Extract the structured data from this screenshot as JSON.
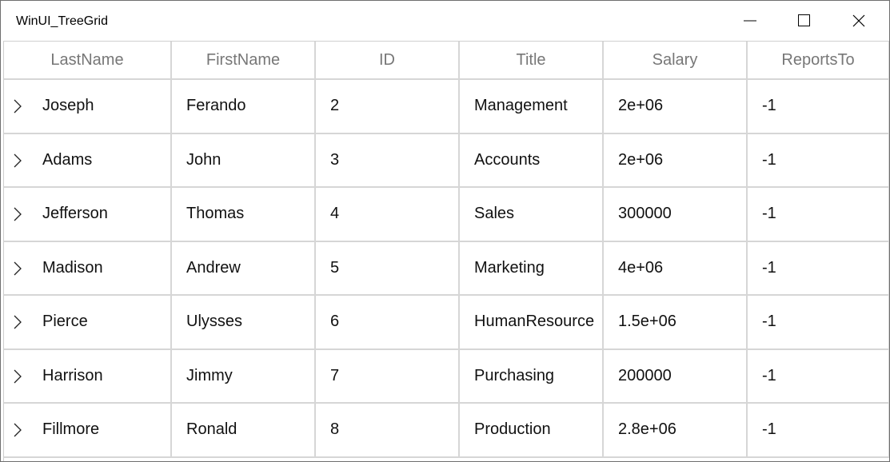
{
  "window": {
    "title": "WinUI_TreeGrid",
    "controls": [
      "minimize-icon",
      "maximize-icon",
      "close-icon"
    ]
  },
  "grid": {
    "columns": [
      "LastName",
      "FirstName",
      "ID",
      "Title",
      "Salary",
      "ReportsTo"
    ],
    "rows": [
      [
        "Joseph",
        "Ferando",
        "2",
        "Management",
        "2e+06",
        "-1"
      ],
      [
        "Adams",
        "John",
        "3",
        "Accounts",
        "2e+06",
        "-1"
      ],
      [
        "Jefferson",
        "Thomas",
        "4",
        "Sales",
        "300000",
        "-1"
      ],
      [
        "Madison",
        "Andrew",
        "5",
        "Marketing",
        "4e+06",
        "-1"
      ],
      [
        "Pierce",
        "Ulysses",
        "6",
        "HumanResource",
        "1.5e+06",
        "-1"
      ],
      [
        "Harrison",
        "Jimmy",
        "7",
        "Purchasing",
        "200000",
        "-1"
      ],
      [
        "Fillmore",
        "Ronald",
        "8",
        "Production",
        "2.8e+06",
        "-1"
      ]
    ],
    "row_expander_icon": "chevron-right-icon",
    "colors": {
      "gridline": "#d6d6d6",
      "header_text": "#777777",
      "cell_text": "#111111"
    }
  }
}
